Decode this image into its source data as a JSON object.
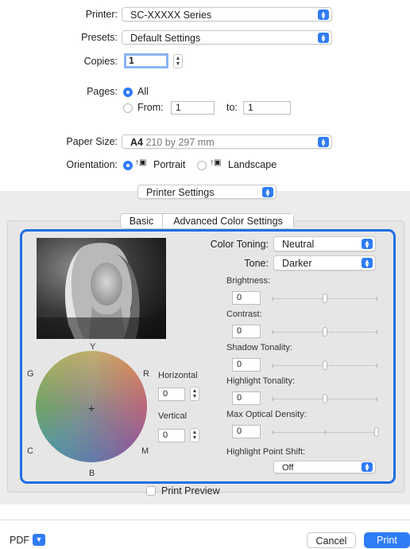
{
  "printer": {
    "label": "Printer:",
    "value": "SC-XXXXX Series"
  },
  "presets": {
    "label": "Presets:",
    "value": "Default Settings"
  },
  "copies": {
    "label": "Copies:",
    "value": "1"
  },
  "pages": {
    "label": "Pages:",
    "all": "All",
    "from_label": "From:",
    "from_value": "1",
    "to_label": "to:",
    "to_value": "1"
  },
  "paper_size": {
    "label": "Paper Size:",
    "value_bold": "A4",
    "value_rest": "210 by 297 mm"
  },
  "orientation": {
    "label": "Orientation:",
    "portrait": "Portrait",
    "landscape": "Landscape"
  },
  "section_popup": {
    "value": "Printer Settings"
  },
  "tabs": [
    {
      "label": "Basic"
    },
    {
      "label": "Advanced Color Settings"
    }
  ],
  "color_toning": {
    "label": "Color Toning:",
    "value": "Neutral"
  },
  "tone": {
    "label": "Tone:",
    "value": "Darker"
  },
  "sliders": [
    {
      "label": "Brightness:",
      "value": "0",
      "level": 0.5
    },
    {
      "label": "Contrast:",
      "value": "0",
      "level": 0.5
    },
    {
      "label": "Shadow Tonality:",
      "value": "0",
      "level": 0.5
    },
    {
      "label": "Highlight Tonality:",
      "value": "0",
      "level": 0.5
    },
    {
      "label": "Max Optical Density:",
      "value": "0",
      "level": 1.0
    }
  ],
  "highlight_point_shift": {
    "label": "Highlight Point Shift:",
    "value": "Off"
  },
  "color_wheel": {
    "y": "Y",
    "r": "R",
    "m": "M",
    "b": "B",
    "c": "C",
    "g": "G"
  },
  "horizontal": {
    "label": "Horizontal",
    "value": "0"
  },
  "vertical": {
    "label": "Vertical",
    "value": "0"
  },
  "print_preview": {
    "label": "Print Preview"
  },
  "footer": {
    "pdf": "PDF",
    "cancel": "Cancel",
    "print": "Print"
  },
  "colors": {
    "accent": "#2f7cf6",
    "highlight_border": "#1f6fe5"
  }
}
